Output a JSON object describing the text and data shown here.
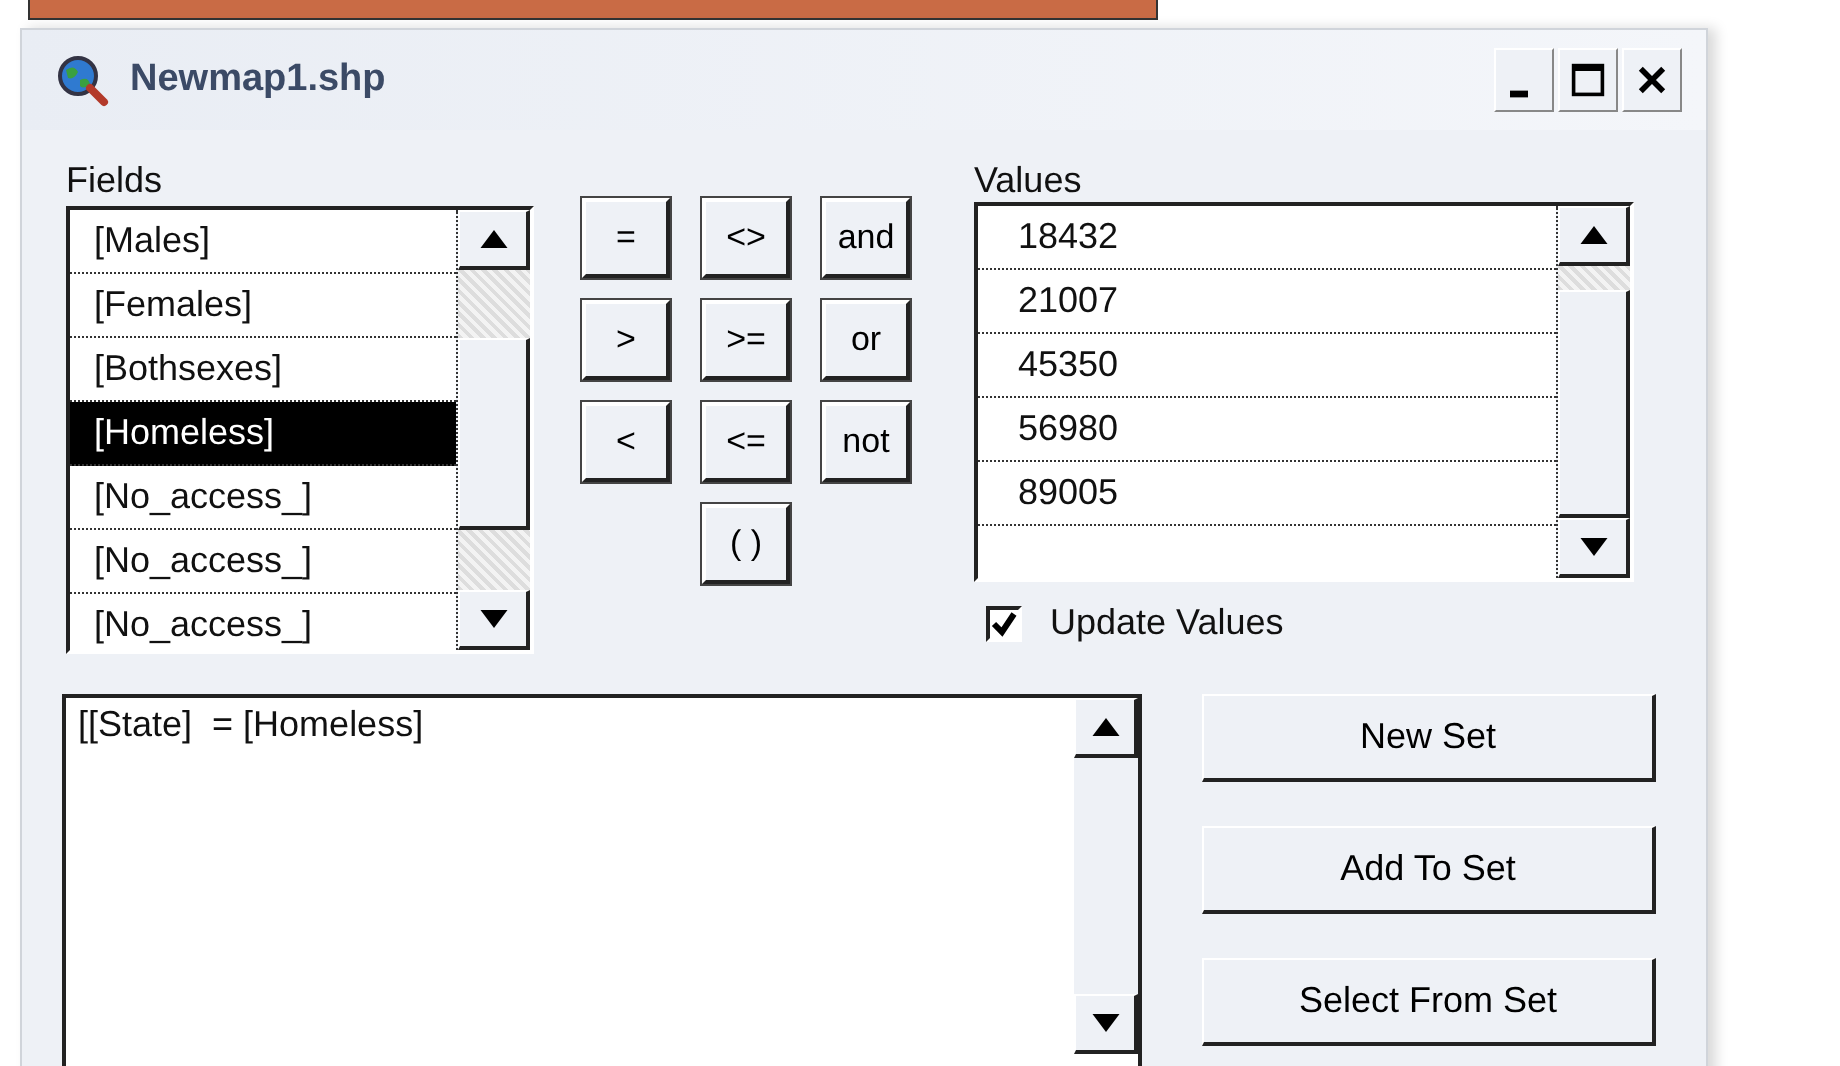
{
  "window": {
    "title": "Newmap1.shp"
  },
  "fields": {
    "label": "Fields",
    "items": [
      {
        "text": "[Males]",
        "selected": false
      },
      {
        "text": "[Females]",
        "selected": false
      },
      {
        "text": "[Bothsexes]",
        "selected": false
      },
      {
        "text": "[Homeless]",
        "selected": true
      },
      {
        "text": "[No_access_]",
        "selected": false
      },
      {
        "text": "[No_access_]",
        "selected": false
      },
      {
        "text": "[No_access_]",
        "selected": false
      }
    ]
  },
  "operators": [
    "=",
    "<>",
    "and",
    ">",
    ">=",
    "or",
    "<",
    "<=",
    "not",
    "( )"
  ],
  "values": {
    "label": "Values",
    "items": [
      "18432",
      "21007",
      "45350",
      "56980",
      "89005"
    ]
  },
  "update_values": {
    "label": "Update Values",
    "checked": true
  },
  "expression": {
    "value": "[[State]  = [Homeless]"
  },
  "buttons": [
    "New Set",
    "Add To Set",
    "Select From Set"
  ]
}
